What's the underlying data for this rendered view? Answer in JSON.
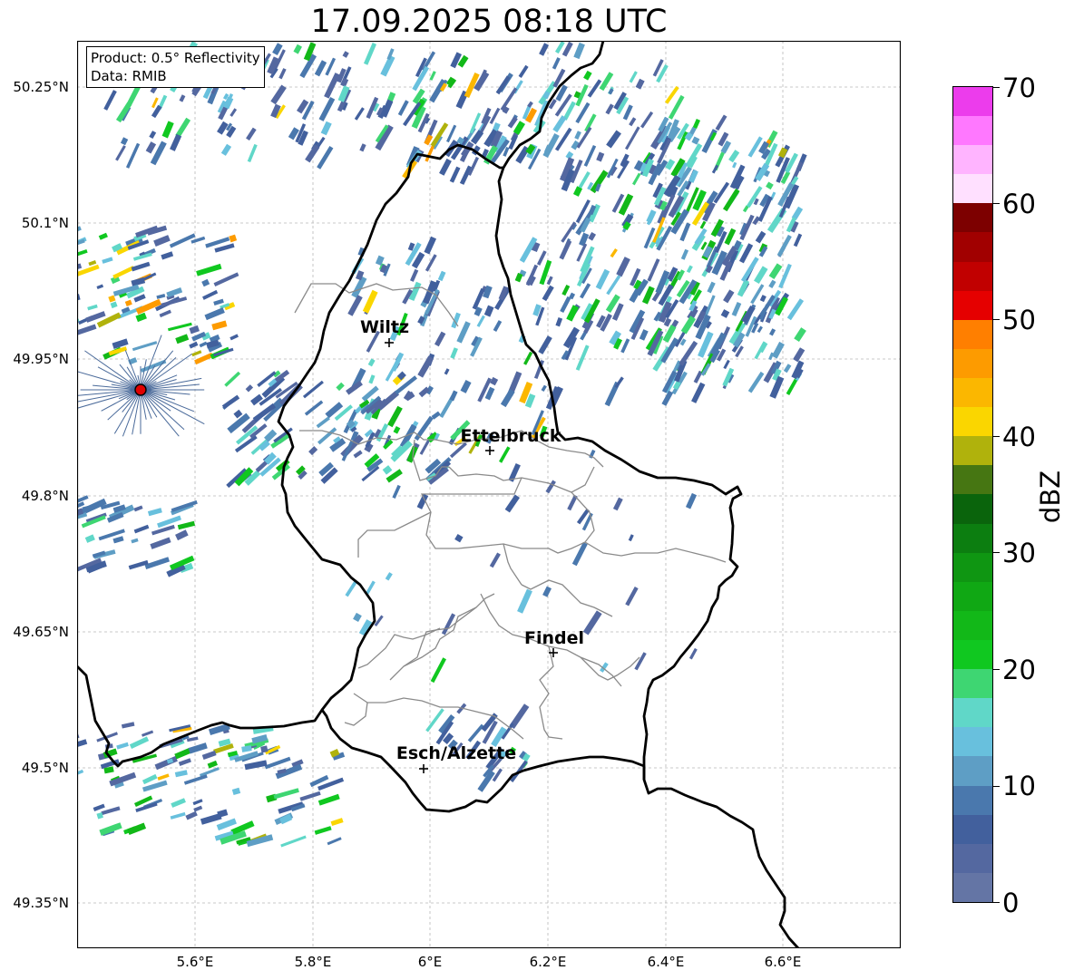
{
  "title": "17.09.2025 08:18 UTC",
  "info": {
    "product": "Product: 0.5° Reflectivity",
    "data": "Data: RMIB"
  },
  "latitude_labels": [
    "50.25°N",
    "50.1°N",
    "49.95°N",
    "49.8°N",
    "49.65°N",
    "49.5°N",
    "49.35°N"
  ],
  "longitude_labels": [
    "5.6°E",
    "5.8°E",
    "6°E",
    "6.2°E",
    "6.4°E",
    "6.6°E"
  ],
  "map_extent": {
    "lon_range": [
      5.4,
      6.8
    ],
    "lat_range": [
      49.3,
      50.3
    ]
  },
  "cities": [
    {
      "name": "Wiltz",
      "lon": 5.93,
      "lat": 49.968
    },
    {
      "name": "Ettelbruck",
      "lon": 6.1,
      "lat": 49.848
    },
    {
      "name": "Findel",
      "lon": 6.21,
      "lat": 49.627
    },
    {
      "name": "Esch/Alzette",
      "lon": 5.99,
      "lat": 49.498
    }
  ],
  "radar_site": {
    "lon": 5.505,
    "lat": 49.914
  },
  "colorbar": {
    "label": "dBZ",
    "min": 0,
    "max": 70,
    "tick_labels": [
      "0",
      "10",
      "20",
      "30",
      "40",
      "50",
      "60",
      "70"
    ],
    "colors": [
      "#6475a5",
      "#5468a0",
      "#42609d",
      "#4a78ad",
      "#5e9ec5",
      "#68c0dd",
      "#60d7c8",
      "#3ed672",
      "#10c820",
      "#12b818",
      "#10a814",
      "#0f9612",
      "#0c7e10",
      "#0a640c",
      "#467612",
      "#b0b20c",
      "#fad600",
      "#fbb700",
      "#fd9b00",
      "#ff7f00",
      "#e50000",
      "#c10000",
      "#a10000",
      "#7d0000",
      "#ffe0ff",
      "#ffb4ff",
      "#ff78ff",
      "#ec3cec"
    ]
  }
}
